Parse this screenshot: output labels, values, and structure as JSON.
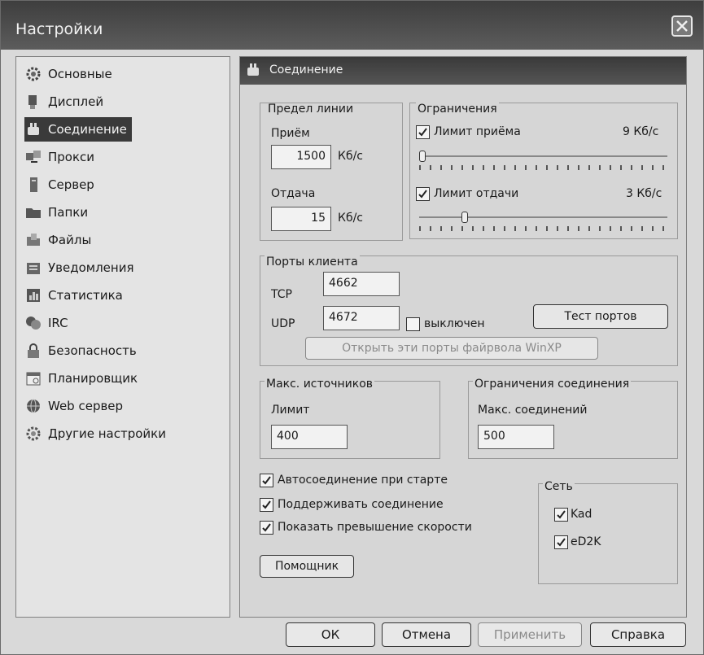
{
  "window": {
    "title": "Настройки"
  },
  "sidebar": {
    "items": [
      {
        "label": "Основные",
        "icon": "general-icon"
      },
      {
        "label": "Дисплей",
        "icon": "display-icon"
      },
      {
        "label": "Соединение",
        "icon": "connection-icon",
        "active": true
      },
      {
        "label": "Прокси",
        "icon": "proxy-icon"
      },
      {
        "label": "Сервер",
        "icon": "server-icon"
      },
      {
        "label": "Папки",
        "icon": "folders-icon"
      },
      {
        "label": "Файлы",
        "icon": "files-icon"
      },
      {
        "label": "Уведомления",
        "icon": "notifications-icon"
      },
      {
        "label": "Статистика",
        "icon": "statistics-icon"
      },
      {
        "label": "IRC",
        "icon": "irc-icon"
      },
      {
        "label": "Безопасность",
        "icon": "security-icon"
      },
      {
        "label": "Планировщик",
        "icon": "scheduler-icon"
      },
      {
        "label": "Web сервер",
        "icon": "web-server-icon"
      },
      {
        "label": "Другие настройки",
        "icon": "other-settings-icon"
      }
    ]
  },
  "panel": {
    "header": "Соединение",
    "line_limit": {
      "title": "Предел линии",
      "download_label": "Приём",
      "download_value": "1500",
      "upload_label": "Отдача",
      "upload_value": "15",
      "unit": "Кб/с"
    },
    "limits": {
      "title": "Ограничения",
      "download_limit_label": "Лимит приёма",
      "download_limit_value": "9 Кб/с",
      "download_limit_checked": true,
      "download_slider_level": 0.0,
      "upload_limit_label": "Лимит отдачи",
      "upload_limit_value": "3 Кб/с",
      "upload_limit_checked": true,
      "upload_slider_level": 0.17
    },
    "client_ports": {
      "title": "Порты клиента",
      "tcp_label": "TCP",
      "tcp_value": "4662",
      "udp_label": "UDP",
      "udp_value": "4672",
      "disabled_label": "выключен",
      "disabled_checked": false,
      "test_button": "Тест портов",
      "firewall_button": "Открыть эти порты файрвола WinXP"
    },
    "max_sources": {
      "title": "Макс. источников",
      "limit_label": "Лимит",
      "limit_value": "400"
    },
    "connection_limits": {
      "title": "Ограничения соединения",
      "max_label": "Макс. соединений",
      "max_value": "500"
    },
    "options": [
      {
        "label": "Автосоединение при старте",
        "checked": true
      },
      {
        "label": "Поддерживать соединение",
        "checked": true
      },
      {
        "label": "Показать превышение скорости",
        "checked": true
      }
    ],
    "wizard_button": "Помощник",
    "network": {
      "title": "Сеть",
      "kad_label": "Kad",
      "kad_checked": true,
      "ed2k_label": "eD2K",
      "ed2k_checked": true
    }
  },
  "footer": {
    "ok": "ОК",
    "cancel": "Отмена",
    "apply": "Применить",
    "help": "Справка"
  }
}
